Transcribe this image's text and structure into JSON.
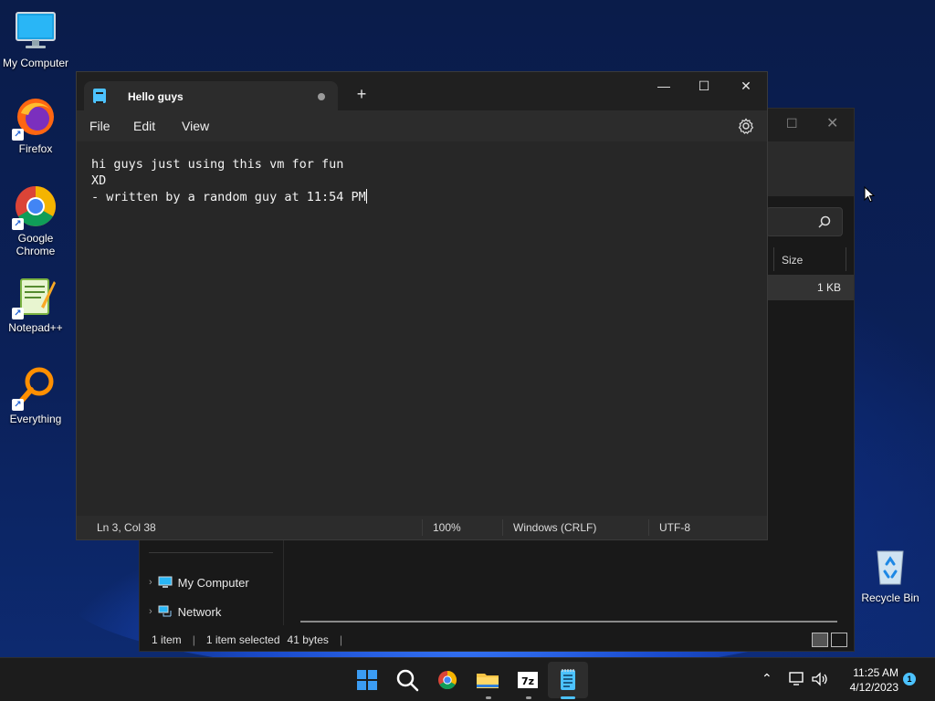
{
  "desktop": {
    "icons": [
      {
        "label": "My Computer",
        "icon": "monitor-icon"
      },
      {
        "label": "Firefox",
        "icon": "firefox-icon"
      },
      {
        "label": "Google Chrome",
        "icon": "chrome-icon"
      },
      {
        "label": "Notepad++",
        "icon": "notepadpp-icon"
      },
      {
        "label": "Everything",
        "icon": "everything-icon"
      },
      {
        "label": "Recycle Bin",
        "icon": "recycle-bin-icon"
      }
    ]
  },
  "explorer": {
    "column_size": "Size",
    "row_size": "1 KB",
    "nav": [
      {
        "label": "My Computer",
        "icon": "monitor-icon"
      },
      {
        "label": "Network",
        "icon": "network-icon"
      }
    ],
    "status": {
      "items": "1 item",
      "selected": "1 item selected",
      "bytes": "41 bytes"
    }
  },
  "notepad": {
    "tab_title": "Hello guys",
    "menu": [
      "File",
      "Edit",
      "View"
    ],
    "content_lines": [
      "hi guys just using this vm for fun",
      "XD",
      "- written by a random guy at 11:54 PM"
    ],
    "status": {
      "position": "Ln 3, Col 38",
      "zoom": "100%",
      "line_ending": "Windows (CRLF)",
      "encoding": "UTF-8"
    },
    "window_controls": {
      "minimize": "—",
      "maximize": "☐",
      "close": "✕"
    }
  },
  "taskbar": {
    "apps": [
      "start-icon",
      "search-icon",
      "chrome-icon",
      "file-explorer-icon",
      "7zip-icon",
      "notepad-icon"
    ],
    "clock": {
      "time": "11:25 AM",
      "date": "4/12/2023"
    },
    "notifications": "1"
  },
  "colors": {
    "accent": "#4cc2ff",
    "notepad_bg": "#272727",
    "taskbar_bg": "#1c1c1c"
  }
}
